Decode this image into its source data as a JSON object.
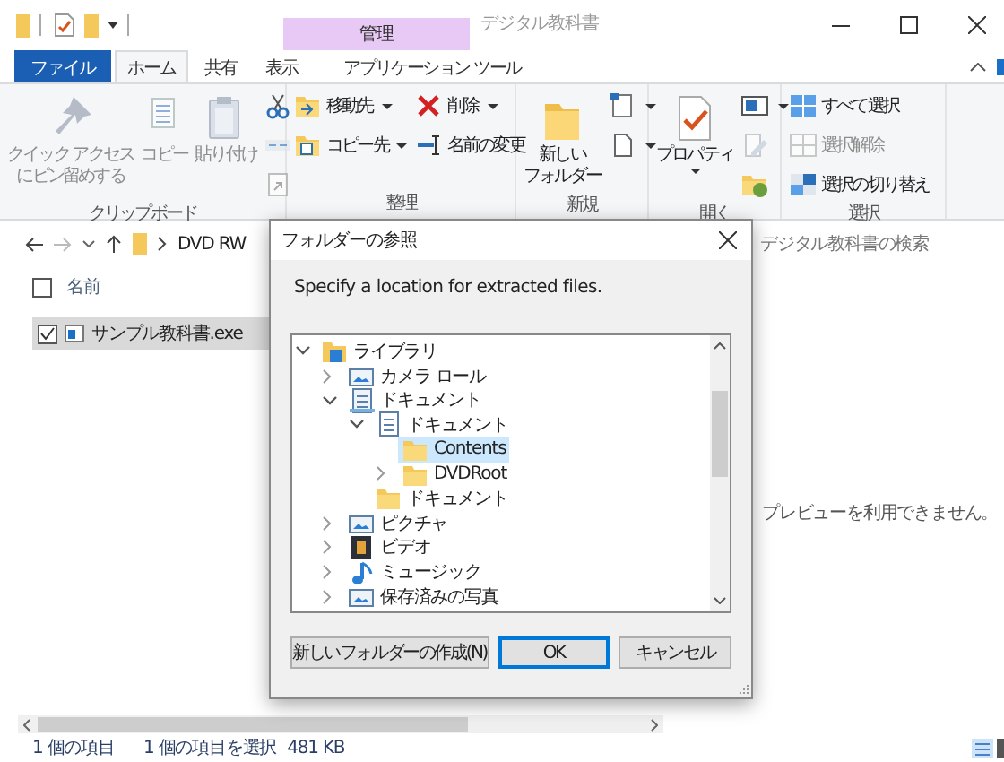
{
  "window": {
    "context_group": "管理",
    "title": "デジタル教科書"
  },
  "tabs": [
    {
      "label": "ファイル",
      "kind": "file",
      "selected": false
    },
    {
      "label": "ホーム",
      "kind": "normal",
      "selected": true
    },
    {
      "label": "共有",
      "kind": "normal",
      "selected": false
    },
    {
      "label": "表示",
      "kind": "normal",
      "selected": false
    },
    {
      "label": "アプリケーション ツール",
      "kind": "context",
      "selected": false
    }
  ],
  "ribbon": {
    "groups": [
      {
        "name": "クリップボード",
        "columns": [
          [
            {
              "kind": "large",
              "lines": [
                "クイック アクセス",
                "にピン留めする"
              ],
              "disabled": true
            }
          ],
          [
            {
              "kind": "large",
              "label": "コピー",
              "disabled": true
            }
          ],
          [
            {
              "kind": "large",
              "label": "貼り付け",
              "disabled": true
            }
          ],
          [
            {
              "kind": "small",
              "disabled": false
            },
            {
              "kind": "small",
              "disabled": true
            },
            {
              "kind": "small",
              "disabled": true
            }
          ]
        ]
      },
      {
        "name": "整理",
        "columns": [
          [
            {
              "kind": "small",
              "label": "移動先",
              "dropdown": true,
              "disabled": false
            },
            {
              "kind": "small",
              "label": "コピー先",
              "dropdown": true,
              "disabled": false
            }
          ],
          [
            {
              "kind": "small",
              "label": "削除",
              "dropdown": true,
              "disabled": false
            },
            {
              "kind": "small",
              "label": "名前の変更",
              "disabled": false
            }
          ]
        ]
      },
      {
        "name": "新規",
        "columns": [
          [
            {
              "kind": "large",
              "lines": [
                "新しい",
                "フォルダー"
              ],
              "disabled": false
            }
          ],
          [
            {
              "kind": "small",
              "dropdown": true,
              "disabled": false
            },
            {
              "kind": "small",
              "dropdown": true,
              "disabled": false
            }
          ]
        ]
      },
      {
        "name": "開く",
        "columns": [
          [
            {
              "kind": "large",
              "label": "プロパティ",
              "dropdown": true,
              "disabled": false
            }
          ],
          [
            {
              "kind": "small",
              "dropdown": true,
              "disabled": false
            },
            {
              "kind": "small",
              "disabled": true
            },
            {
              "kind": "small",
              "disabled": false
            }
          ]
        ]
      },
      {
        "name": "選択",
        "columns": [
          [
            {
              "kind": "small",
              "label": "すべて選択",
              "disabled": false
            },
            {
              "kind": "small",
              "label": "選択解除",
              "disabled": true
            },
            {
              "kind": "small",
              "label": "選択の切り替え",
              "disabled": false
            }
          ]
        ]
      }
    ]
  },
  "address": {
    "path": [
      "DVD RW"
    ],
    "search_placeholder": "デジタル教科書の検索"
  },
  "file_list": {
    "header_checked": false,
    "columns": [
      {
        "label": "名前"
      }
    ],
    "rows": [
      {
        "name": "サンプル教科書.exe",
        "checked": true,
        "selected": true
      }
    ]
  },
  "preview": {
    "message": "プレビューを利用できません。"
  },
  "status_bar": {
    "item_count": "1 個の項目",
    "selection": "1 個の項目を選択",
    "size": "481 KB"
  },
  "dialog": {
    "title": "フォルダーの参照",
    "instruction": "Specify a location for extracted files.",
    "tree": [
      {
        "label": "ライブラリ",
        "kind": "library",
        "expanded": true,
        "selected": false,
        "children": [
          {
            "label": "カメラ ロール",
            "kind": "pictures",
            "expanded": false,
            "selected": false
          },
          {
            "label": "ドキュメント",
            "kind": "docs",
            "expanded": true,
            "selected": false,
            "children": [
              {
                "label": "ドキュメント",
                "kind": "doc",
                "expanded": true,
                "selected": false,
                "children": [
                  {
                    "label": "Contents",
                    "kind": "folder",
                    "selected": true
                  },
                  {
                    "label": "DVDRoot",
                    "kind": "folder",
                    "expanded": false,
                    "selected": false
                  }
                ]
              },
              {
                "label": "ドキュメント",
                "kind": "folder",
                "selected": false
              }
            ]
          },
          {
            "label": "ピクチャ",
            "kind": "pictures",
            "expanded": false,
            "selected": false
          },
          {
            "label": "ビデオ",
            "kind": "video",
            "expanded": false,
            "selected": false
          },
          {
            "label": "ミュージック",
            "kind": "music",
            "expanded": false,
            "selected": false
          },
          {
            "label": "保存済みの写真",
            "kind": "pictures",
            "expanded": false,
            "selected": false
          }
        ]
      }
    ],
    "buttons": [
      {
        "label": "新しいフォルダーの作成(N)",
        "default": false
      },
      {
        "label": "OK",
        "default": true
      },
      {
        "label": "キャンセル",
        "default": false
      }
    ]
  }
}
